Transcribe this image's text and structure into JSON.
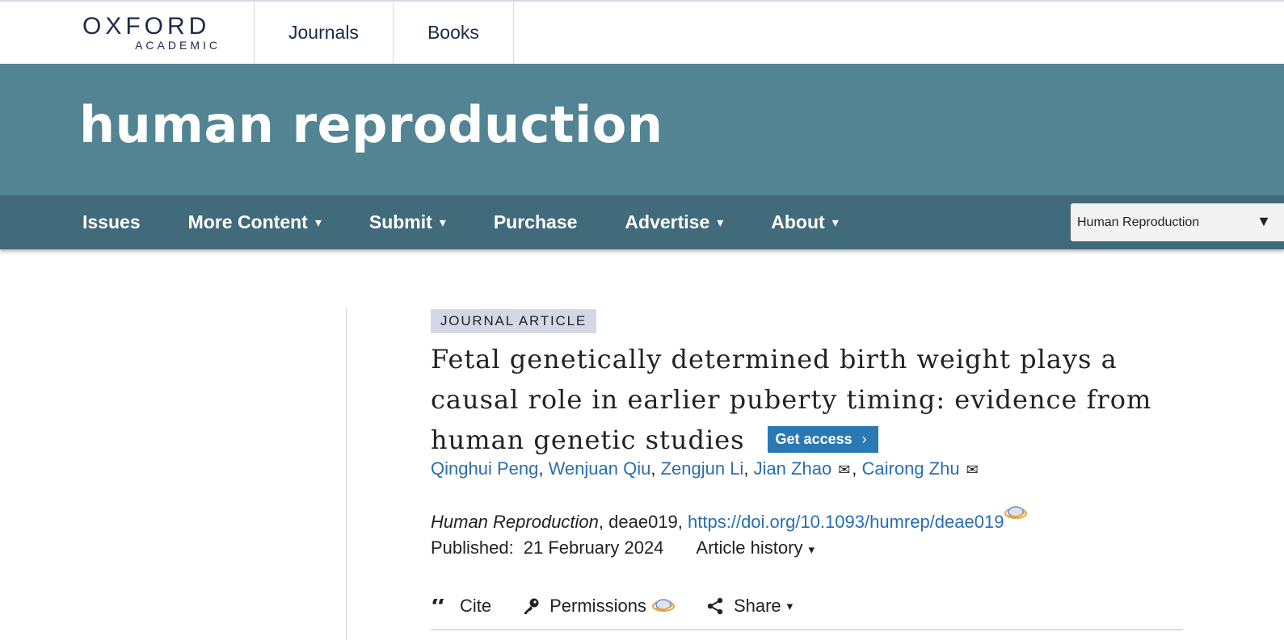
{
  "site": {
    "logo": {
      "top": "OXFORD",
      "bottom": "ACADEMIC"
    },
    "top_nav": [
      {
        "label": "Journals"
      },
      {
        "label": "Books"
      }
    ]
  },
  "journal": {
    "title": "human reproduction",
    "banner_color": "#538494",
    "nav_color": "#416a7a",
    "nav_items": [
      {
        "label": "Issues",
        "has_caret": false
      },
      {
        "label": "More Content",
        "has_caret": true
      },
      {
        "label": "Submit",
        "has_caret": true
      },
      {
        "label": "Purchase",
        "has_caret": false
      },
      {
        "label": "Advertise",
        "has_caret": true
      },
      {
        "label": "About",
        "has_caret": true
      }
    ],
    "search_select": {
      "selected": "Human Reproduction"
    },
    "caret_glyph": "▾"
  },
  "article": {
    "type_badge": "JOURNAL ARTICLE",
    "title": "Fetal genetically determined birth weight plays a causal role in earlier puberty timing: evidence from human genetic studies",
    "get_access_label": "Get access",
    "authors": [
      {
        "name": "Qinghui Peng",
        "corresponding": false
      },
      {
        "name": "Wenjuan Qiu",
        "corresponding": false
      },
      {
        "name": "Zengjun Li",
        "corresponding": false
      },
      {
        "name": "Jian Zhao",
        "corresponding": true
      },
      {
        "name": "Cairong Zhu",
        "corresponding": true
      }
    ],
    "citation": {
      "journal": "Human Reproduction",
      "article_id": "deae019",
      "doi": "https://doi.org/10.1093/humrep/deae019"
    },
    "published_label": "Published:",
    "published_date": "21 February 2024",
    "history_label": "Article history",
    "tools": {
      "cite": "Cite",
      "permissions": "Permissions",
      "share": "Share"
    },
    "link_color": "#2a6eb0",
    "access_button_color": "#2a79b5"
  }
}
